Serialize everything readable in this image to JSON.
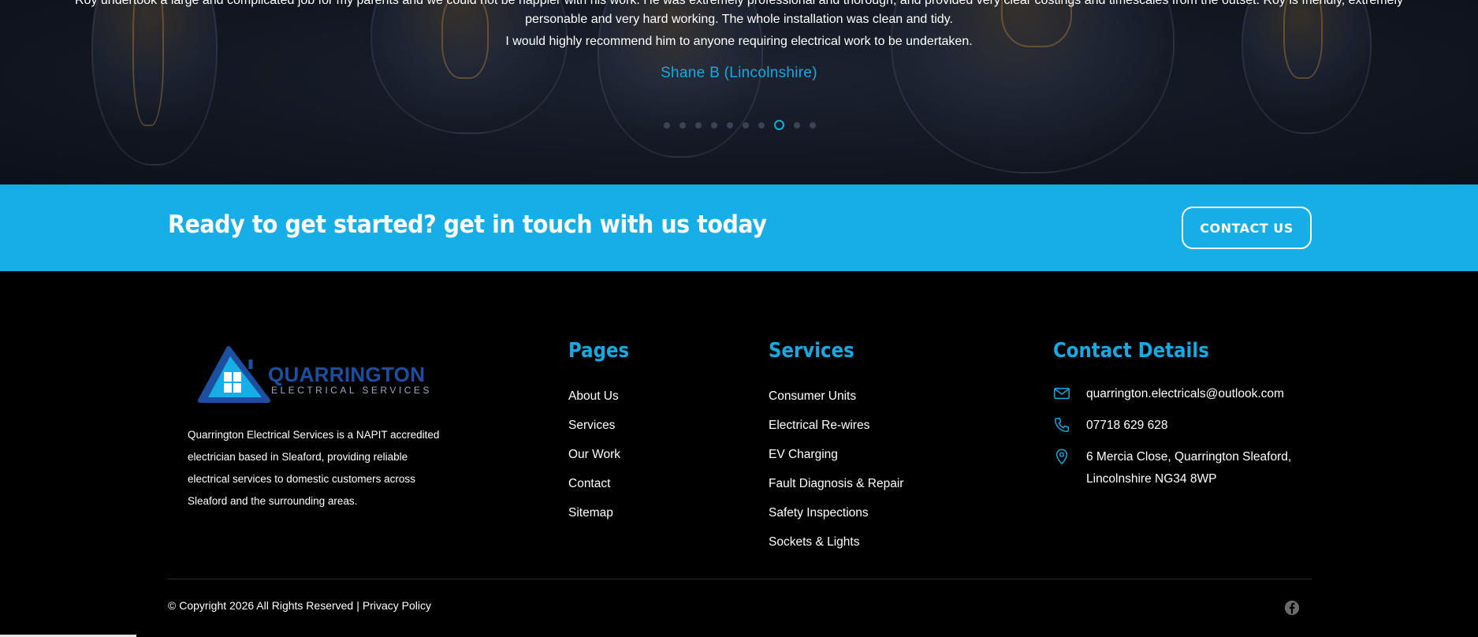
{
  "testimonial": {
    "lines": [
      "Roy undertook a large and complicated job for my parents and we could not be happier with his work. He was extremely professional and thorough, and provided very clear costings and timescales from the outset. Roy is friendly, extremely",
      "personable and very hard working. The whole installation was clean and tidy.",
      "I would highly recommend him to anyone requiring electrical work to be undertaken."
    ],
    "author": "Shane B (Lincolnshire)",
    "slide_count": 10,
    "active_slide": 8
  },
  "cta": {
    "title": "Ready to get started? get in touch with us today",
    "button_label": "CONTACT US"
  },
  "footer": {
    "logo": {
      "name": "QUARRINGTON",
      "sub": "ELECTRICAL SERVICES"
    },
    "about": "Quarrington Electrical Services is a NAPIT accredited electrician based in Sleaford, providing reliable electrical services to domestic customers across Sleaford and the surrounding areas.",
    "pages": {
      "title": "Pages",
      "items": [
        "About Us",
        "Services",
        "Our Work",
        "Contact",
        "Sitemap"
      ]
    },
    "services": {
      "title": "Services",
      "items": [
        "Consumer Units",
        "Electrical Re-wires",
        "EV Charging",
        "Fault Diagnosis & Repair",
        "Safety Inspections",
        "Sockets & Lights"
      ]
    },
    "contact": {
      "title": "Contact Details",
      "email": "quarrington.electricals@outlook.com",
      "phone": "07718 629 628",
      "address_line1": "6 Mercia Close, Quarrington Sleaford,",
      "address_line2": "Lincolnshire NG34 8WP"
    },
    "copyright": "© Copyright 2026 All Rights Reserved",
    "privacy_label": "Privacy Policy"
  },
  "colors": {
    "accent": "#17a9e1",
    "cta_background": "#17aee8",
    "logo_blue": "#1c4fa0",
    "footer_background": "#000000"
  },
  "icons": {
    "email": "envelope-icon",
    "phone": "phone-icon",
    "address": "map-pin-icon",
    "social": "facebook-icon"
  }
}
